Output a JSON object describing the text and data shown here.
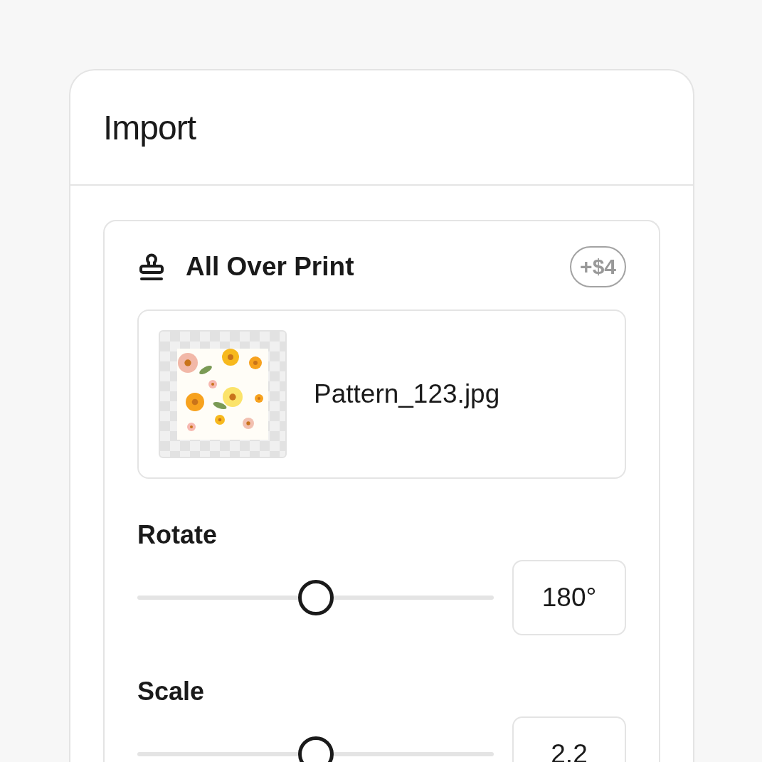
{
  "panel": {
    "title": "Import"
  },
  "print": {
    "title": "All Over Print",
    "price": "+$4",
    "file": {
      "name": "Pattern_123.jpg"
    }
  },
  "sliders": [
    {
      "label": "Rotate",
      "level": 0.5,
      "value": "180°"
    },
    {
      "label": "Scale",
      "level": 0.5,
      "value": "2.2"
    }
  ]
}
